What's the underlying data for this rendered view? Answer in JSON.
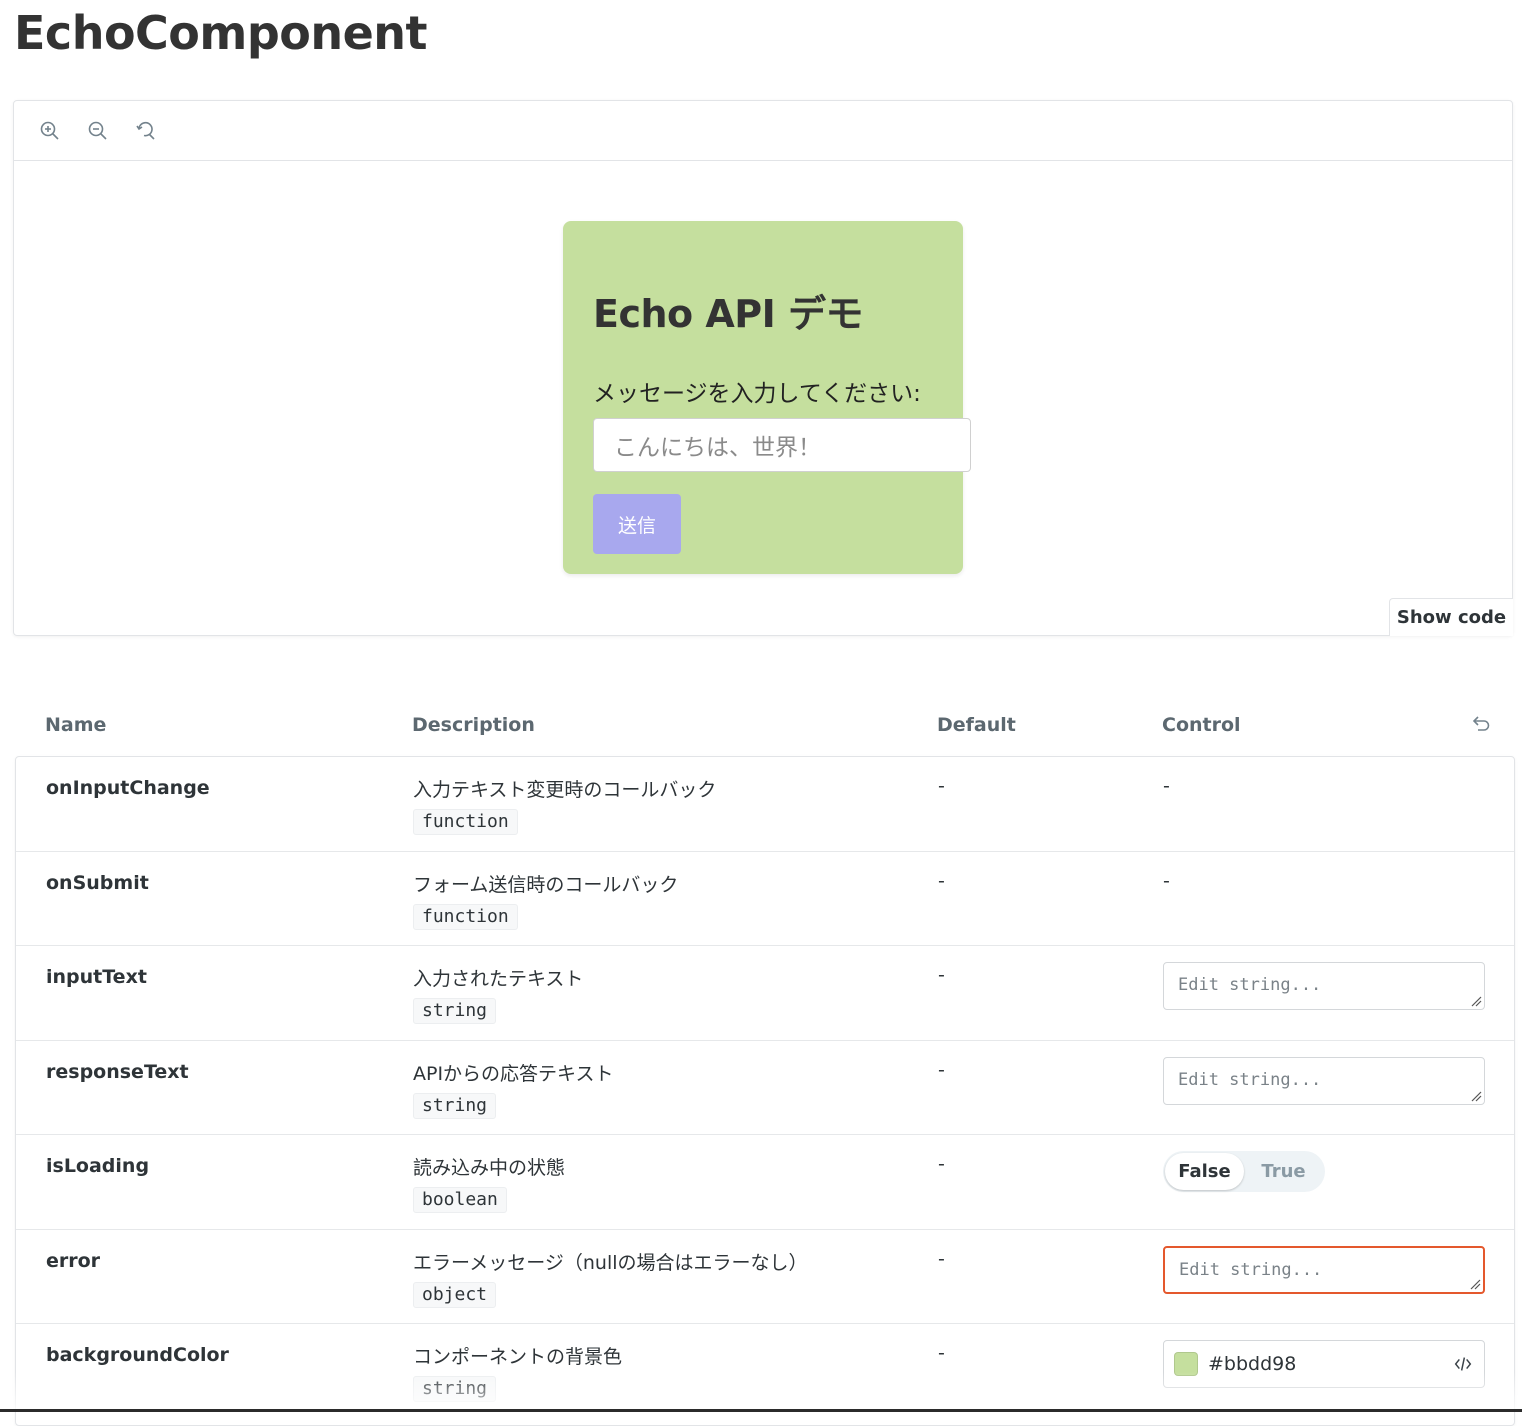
{
  "page": {
    "title": "EchoComponent"
  },
  "toolbar": {
    "zoom_in": "zoom-in-icon",
    "zoom_out": "zoom-out-icon",
    "reset": "zoom-reset-icon"
  },
  "preview": {
    "card_bg": "#c5df9e",
    "title": "Echo API デモ",
    "label": "メッセージを入力してください:",
    "input_placeholder": "こんにちは、世界！",
    "submit_label": "送信",
    "submit_color": "#a8a8ee",
    "show_code_label": "Show code"
  },
  "args_table": {
    "headers": {
      "name": "Name",
      "description": "Description",
      "default": "Default",
      "control": "Control"
    },
    "rows": [
      {
        "name": "onInputChange",
        "description": "入力テキスト変更時のコールバック",
        "type": "function",
        "default": "-",
        "control": "-"
      },
      {
        "name": "onSubmit",
        "description": "フォーム送信時のコールバック",
        "type": "function",
        "default": "-",
        "control": "-"
      },
      {
        "name": "inputText",
        "description": "入力されたテキスト",
        "type": "string",
        "default": "-",
        "control_placeholder": "Edit string..."
      },
      {
        "name": "responseText",
        "description": "APIからの応答テキスト",
        "type": "string",
        "default": "-",
        "control_placeholder": "Edit string..."
      },
      {
        "name": "isLoading",
        "description": "読み込み中の状態",
        "type": "boolean",
        "default": "-",
        "toggle_false": "False",
        "toggle_true": "True"
      },
      {
        "name": "error",
        "description": "エラーメッセージ（nullの場合はエラーなし）",
        "type": "object",
        "default": "-",
        "control_placeholder": "Edit string..."
      },
      {
        "name": "backgroundColor",
        "description": "コンポーネントの背景色",
        "type": "string",
        "default": "-",
        "color_value": "#bbdd98"
      }
    ]
  }
}
